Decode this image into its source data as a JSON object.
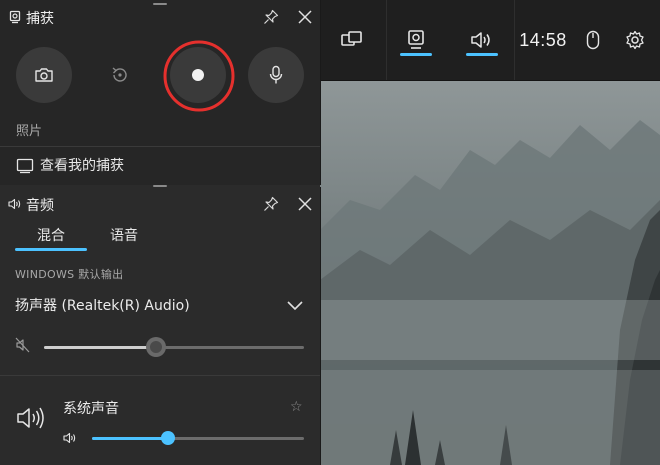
{
  "capture_panel": {
    "title": "捕获",
    "photo_label": "照片",
    "view_captures_label": "查看我的捕获",
    "buttons": [
      {
        "name": "screenshot",
        "icon": "camera-icon"
      },
      {
        "name": "record-last",
        "icon": "replay-icon"
      },
      {
        "name": "record",
        "icon": "record-dot-icon"
      },
      {
        "name": "microphone",
        "icon": "microphone-icon"
      }
    ]
  },
  "audio_panel": {
    "title": "音频",
    "tabs": [
      {
        "label": "混合",
        "active": true
      },
      {
        "label": "语音",
        "active": false
      }
    ],
    "output_section_label": "WINDOWS 默认输出",
    "device_name": "扬声器 (Realtek(R) Audio)",
    "device_volume_fraction": 0.43,
    "apps": [
      {
        "name": "系统声音",
        "volume_fraction": 0.36,
        "favorite": false
      }
    ]
  },
  "topbar": {
    "time": "14:58",
    "items": [
      "widget-icon",
      "capture-icon",
      "audio-icon",
      "mouse-icon",
      "gear-icon"
    ]
  },
  "colors": {
    "accent": "#4cc2ff",
    "record_highlight": "#e5302d"
  }
}
